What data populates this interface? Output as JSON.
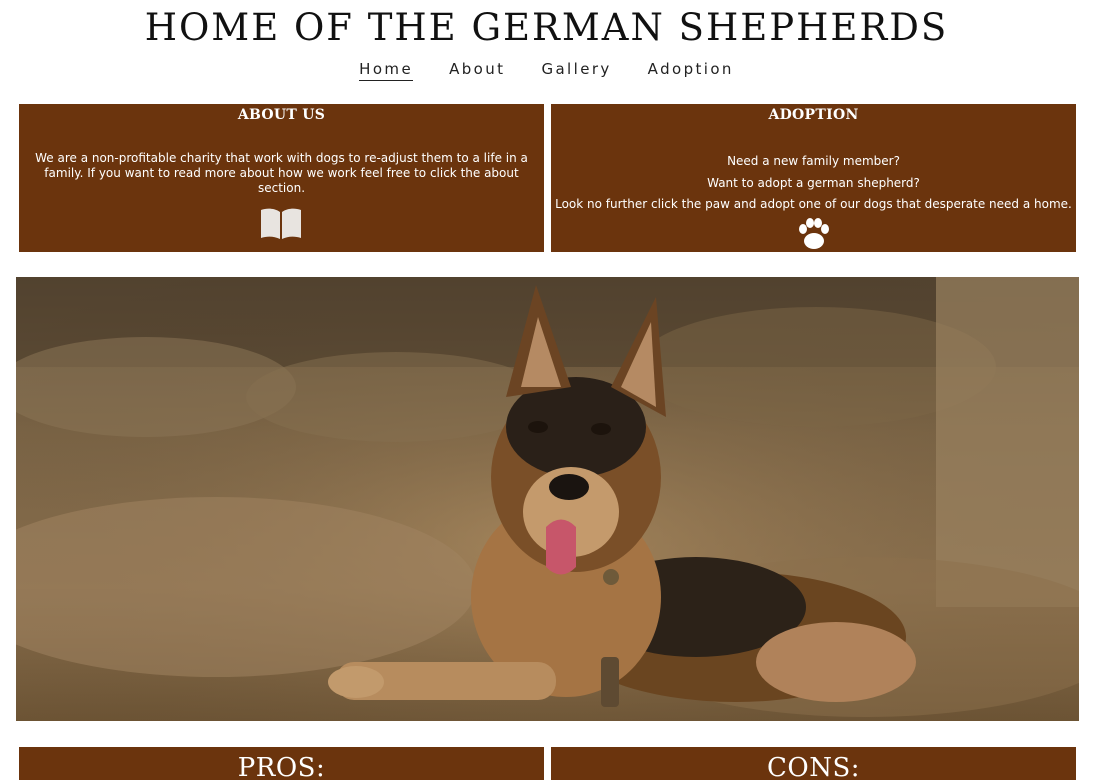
{
  "site": {
    "title": "HOME OF THE GERMAN SHEPHERDS"
  },
  "nav": {
    "items": [
      {
        "label": "Home",
        "active": true
      },
      {
        "label": "About",
        "active": false
      },
      {
        "label": "Gallery",
        "active": false
      },
      {
        "label": "Adoption",
        "active": false
      }
    ]
  },
  "about": {
    "title": "ABOUT US",
    "text": "We are a non-profitable charity that work with dogs to re-adjust them to a life in a family. If you want to read more about how we work feel free to click the about section.",
    "icon": "book-icon"
  },
  "adoption": {
    "title": "ADOPTION",
    "lines": [
      "Need a new family member?",
      "Want to adopt a german shepherd?",
      "Look no further click the paw and adopt one of our dogs that desperate need a home."
    ],
    "icon": "paw-icon"
  },
  "hero": {
    "image": "german-shepherd-lying-in-hay"
  },
  "pros": {
    "title": "PROS:"
  },
  "cons": {
    "title": "CONS:"
  },
  "colors": {
    "panel": "#6b340d",
    "text_on_panel": "#ffffff"
  }
}
